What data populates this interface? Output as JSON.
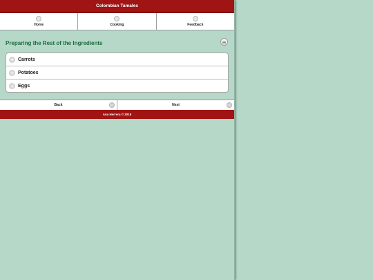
{
  "header": {
    "title": "Colombian Tamales"
  },
  "nav": {
    "items": [
      {
        "label": "Home",
        "icon": "home-icon"
      },
      {
        "label": "Cooking",
        "icon": "cooking-icon"
      },
      {
        "label": "Feedback",
        "icon": "feedback-icon"
      }
    ]
  },
  "page": {
    "title": "Preparing the Rest of the Ingredients",
    "menu_icon": "menu-icon"
  },
  "ingredients": [
    {
      "label": "Carrots",
      "icon": "plus-icon"
    },
    {
      "label": "Potatoes",
      "icon": "plus-icon"
    },
    {
      "label": "Eggs",
      "icon": "plus-icon"
    }
  ],
  "pager": {
    "back_label": "Back",
    "next_label": "Next"
  },
  "footer": {
    "text": "Ana Herrera © 2016"
  },
  "colors": {
    "brand_red": "#a01414",
    "title_green": "#1a6b3c",
    "background": "#b6d8c8"
  }
}
